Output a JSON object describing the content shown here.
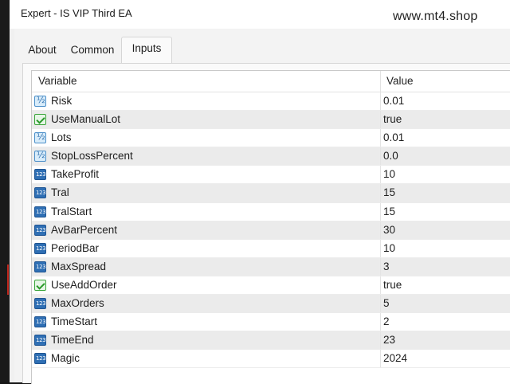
{
  "window": {
    "title": "Expert - IS VIP Third EA",
    "watermark": "www.mt4.shop"
  },
  "tabs": [
    {
      "label": "About",
      "active": false
    },
    {
      "label": "Common",
      "active": false
    },
    {
      "label": "Inputs",
      "active": true
    }
  ],
  "table": {
    "columns": [
      "Variable",
      "Value"
    ],
    "rows": [
      {
        "icon": "double-type-icon",
        "name": "Risk",
        "value": "0.01"
      },
      {
        "icon": "bool-type-icon",
        "name": "UseManualLot",
        "value": "true"
      },
      {
        "icon": "double-type-icon",
        "name": "Lots",
        "value": "0.01"
      },
      {
        "icon": "double-type-icon",
        "name": "StopLossPercent",
        "value": "0.0"
      },
      {
        "icon": "int-type-icon",
        "name": "TakeProfit",
        "value": "10"
      },
      {
        "icon": "int-type-icon",
        "name": "Tral",
        "value": "15"
      },
      {
        "icon": "int-type-icon",
        "name": "TralStart",
        "value": "15"
      },
      {
        "icon": "int-type-icon",
        "name": "AvBarPercent",
        "value": "30"
      },
      {
        "icon": "int-type-icon",
        "name": "PeriodBar",
        "value": "10"
      },
      {
        "icon": "int-type-icon",
        "name": "MaxSpread",
        "value": "3"
      },
      {
        "icon": "bool-type-icon",
        "name": "UseAddOrder",
        "value": "true"
      },
      {
        "icon": "int-type-icon",
        "name": "MaxOrders",
        "value": "5"
      },
      {
        "icon": "int-type-icon",
        "name": "TimeStart",
        "value": "2"
      },
      {
        "icon": "int-type-icon",
        "name": "TimeEnd",
        "value": "23"
      },
      {
        "icon": "int-type-icon",
        "name": "Magic",
        "value": "2024"
      }
    ]
  },
  "colors": {
    "alt_row": "#ebebeb",
    "int_icon": "#2f6fb4",
    "bool_icon": "#3aa53a",
    "double_icon": "#4b8fc9"
  }
}
